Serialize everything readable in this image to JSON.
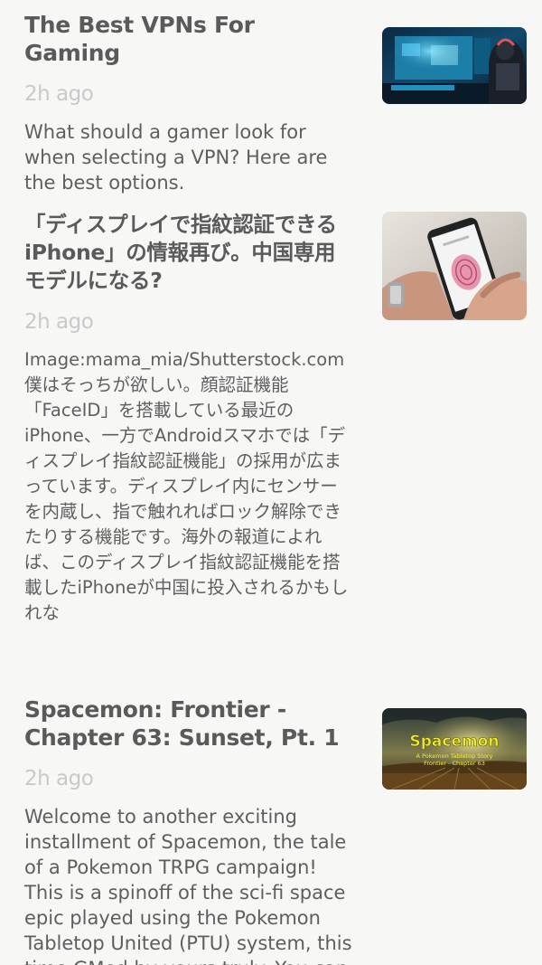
{
  "articles": [
    {
      "title": "The Best VPNs For Gaming",
      "time": "2h ago",
      "summary": "What should a gamer look for when selecting a VPN? Here are the best options.",
      "thumbnail_icon": "gaming-setup-image"
    },
    {
      "title": "「ディスプレイで指紋認証できるiPhone」の情報再び。中国専用モデルになる?",
      "time": "2h ago",
      "summary": "Image:mama_mia/Shutterstock.com 僕はそっちが欲しい。顔認証機能「FaceID」を搭載している最近のiPhone、一方でAndroidスマホでは「ディスプレイ指紋認証機能」の採用が広まっています。ディスプレイ内にセンサーを内蔵し、指で触れればロック解除できたりする機能です。海外の報道によれば、このディスプレイ指紋認証機能を搭載したiPhoneが中国に投入されるかもしれな",
      "thumbnail_icon": "fingerprint-phone-image"
    },
    {
      "title": "Spacemon: Frontier - Chapter 63: Sunset, Pt. 1",
      "time": "2h ago",
      "summary": "Welcome to another exciting installment of Spacemon, the tale of a Pokemon TRPG campaign! This is a spinoff of the sci-fi space epic played using the Pokemon Tabletop United (PTU) system, this time GMed by yours truly. You can get",
      "thumbnail_icon": "spacemon-cover-image",
      "thumbnail_text": {
        "logo": "Spacemon",
        "line1": "A Pokemon Tabletop Story",
        "line2": "Frontier - Chapter 63"
      }
    }
  ]
}
